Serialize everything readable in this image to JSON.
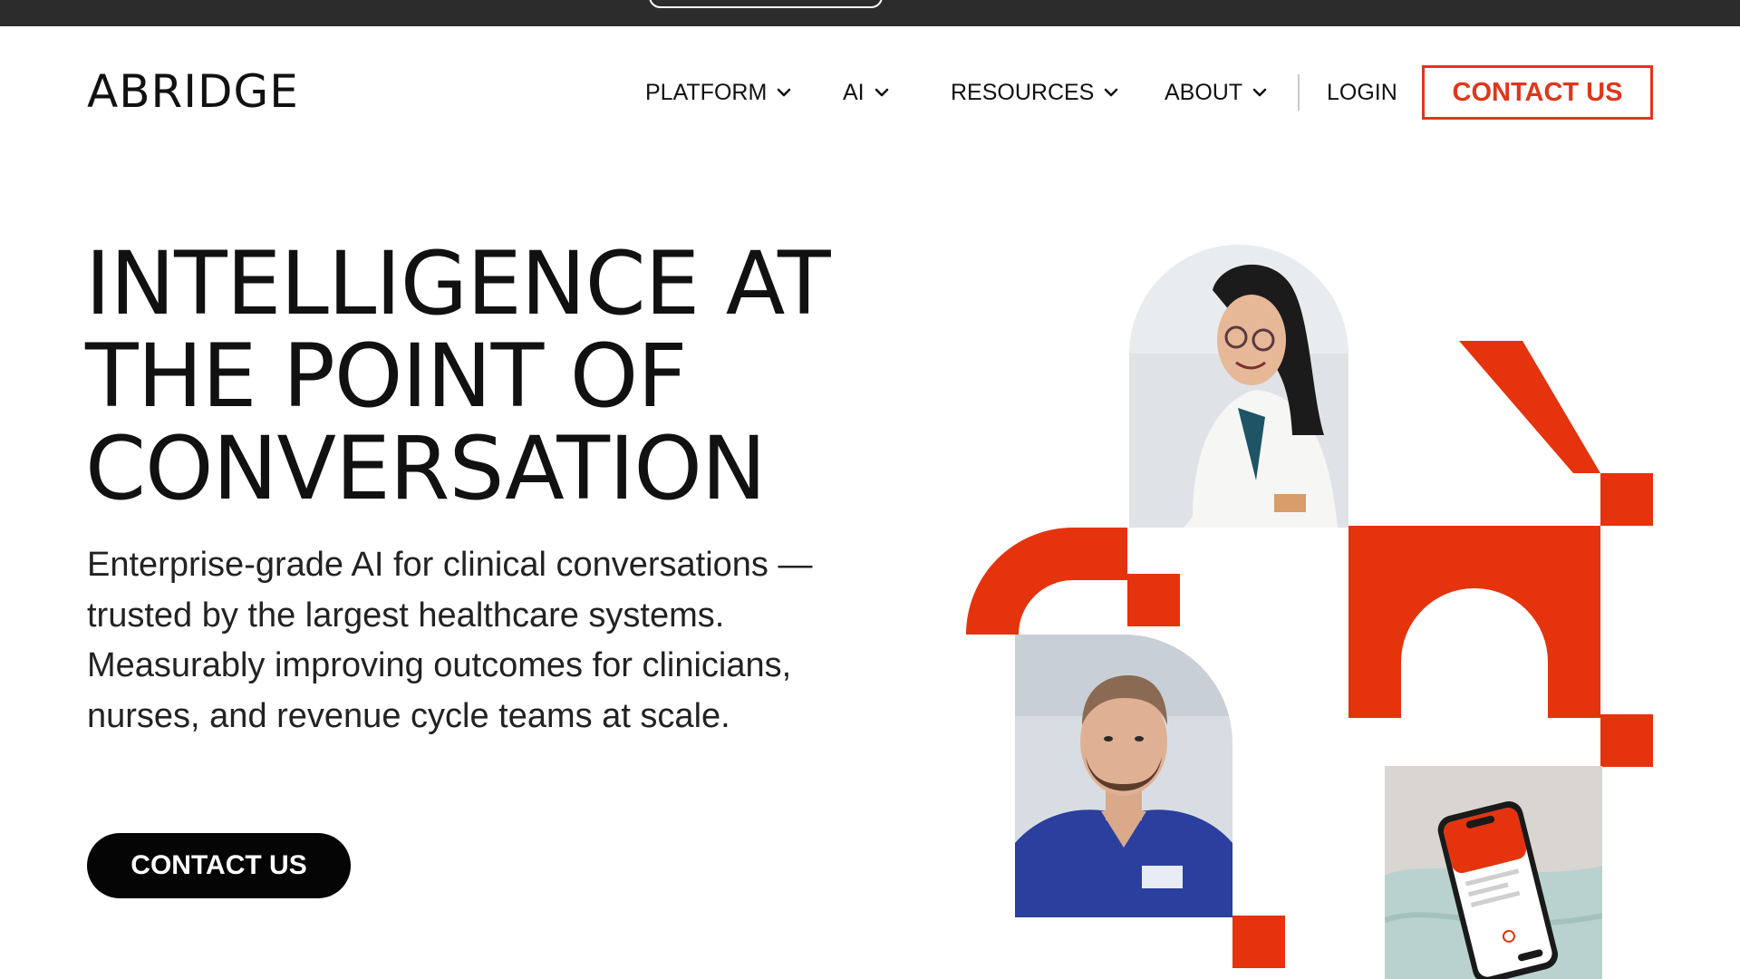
{
  "brand": {
    "logo_text": "ABRIDGE",
    "accent_color": "#e0361b",
    "dark_color": "#050505"
  },
  "nav": {
    "items": [
      {
        "label": "PLATFORM",
        "icon": "chevron-down-icon"
      },
      {
        "label": "AI",
        "icon": "chevron-down-icon"
      },
      {
        "label": "RESOURCES",
        "icon": "chevron-down-icon"
      },
      {
        "label": "ABOUT",
        "icon": "chevron-down-icon"
      }
    ],
    "login_label": "LOGIN",
    "contact_label": "CONTACT US"
  },
  "hero": {
    "title_lines": [
      "INTELLIGENCE AT",
      "THE POINT OF",
      "CONVERSATION"
    ],
    "subtitle": "Enterprise-grade AI for clinical conversations —trusted by the largest healthcare systems. Measurably improving outcomes for clinicians, nurses, and revenue cycle teams at scale.",
    "cta_label": "CONTACT US"
  },
  "artwork": {
    "photos": [
      {
        "name": "clinician-photo",
        "subject": "smiling woman in white coat with glasses"
      },
      {
        "name": "nurse-photo",
        "subject": "bearded man in blue scrubs"
      },
      {
        "name": "phone-app-photo",
        "subject": "phone showing app on bed sheet"
      }
    ]
  }
}
